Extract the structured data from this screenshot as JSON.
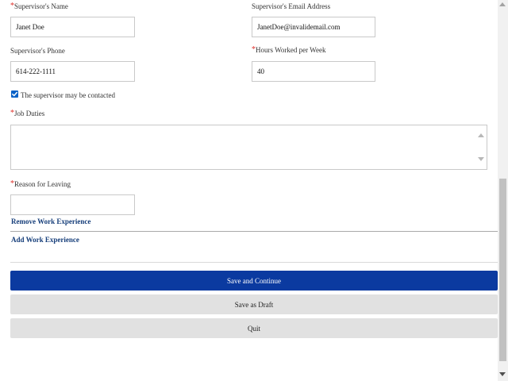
{
  "form": {
    "supervisor_name": {
      "label": "Supervisor's Name",
      "value": "Janet Doe"
    },
    "supervisor_email": {
      "label": "Supervisor's Email Address",
      "value": "JanetDoe@invalidemail.com"
    },
    "supervisor_phone": {
      "label": "Supervisor's Phone",
      "value": "614-222-1111"
    },
    "hours_per_week": {
      "label": "Hours Worked per Week",
      "value": "40"
    },
    "may_contact": {
      "label": "The supervisor may be contacted",
      "checked": true
    },
    "job_duties": {
      "label": "Job Duties",
      "value": ""
    },
    "reason_for_leaving": {
      "label": "Reason for Leaving",
      "value": ""
    },
    "required_marker": "*"
  },
  "links": {
    "remove_work_experience": "Remove Work Experience",
    "add_work_experience": "Add Work Experience"
  },
  "buttons": {
    "save_continue": "Save and Continue",
    "save_draft": "Save as Draft",
    "quit": "Quit"
  },
  "colors": {
    "primary_button": "#0b3aa0",
    "secondary_button": "#e1e1e1",
    "link": "#163e7a",
    "required": "#e0302a",
    "checkbox": "#0a62c7"
  }
}
